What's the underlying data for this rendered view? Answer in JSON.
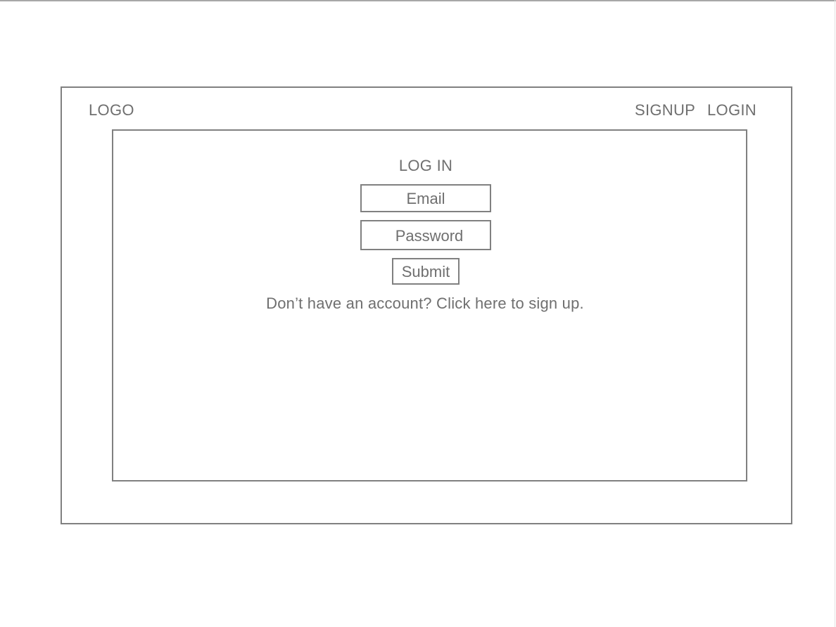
{
  "header": {
    "logo": "LOGO",
    "nav": {
      "signup": "SIGNUP",
      "login": "LOGIN"
    }
  },
  "login_form": {
    "title": "LOG IN",
    "email_placeholder": "Email",
    "password_placeholder": "Password",
    "submit_label": "Submit",
    "signup_prompt": "Don’t have an account? Click here to sign up."
  },
  "colors": {
    "stroke": "#808080",
    "text": "#6f6f6f",
    "background": "#ffffff"
  }
}
